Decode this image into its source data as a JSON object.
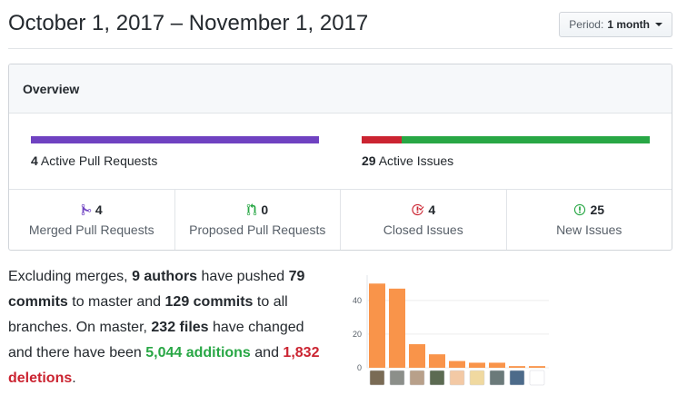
{
  "header": {
    "date_range": "October 1, 2017 – November 1, 2017",
    "period_label": "Period:",
    "period_value": "1 month"
  },
  "overview": {
    "title": "Overview",
    "pull_requests": {
      "count": "4",
      "label": "Active Pull Requests",
      "color": "#6f42c1"
    },
    "issues": {
      "count": "29",
      "label": "Active Issues",
      "closed_color": "#cb2431",
      "open_color": "#28a745",
      "closed": 4,
      "open": 25
    },
    "stats": [
      {
        "icon": "merged-pr-icon",
        "value": "4",
        "label": "Merged Pull Requests",
        "color": "#6f42c1"
      },
      {
        "icon": "proposed-pr-icon",
        "value": "0",
        "label": "Proposed Pull Requests",
        "color": "#28a745"
      },
      {
        "icon": "closed-issue-icon",
        "value": "4",
        "label": "Closed Issues",
        "color": "#cb2431"
      },
      {
        "icon": "new-issue-icon",
        "value": "25",
        "label": "New Issues",
        "color": "#28a745"
      }
    ]
  },
  "summary": {
    "t1": "Excluding merges, ",
    "authors": "9 authors",
    "t2": " have pushed ",
    "commits_master": "79 commits",
    "t3": " to master and ",
    "commits_all": "129 commits",
    "t4": " to all branches. On master, ",
    "files": "232 files",
    "t5": " have changed and there have been ",
    "additions": "5,044 additions",
    "t6": " and ",
    "deletions": "1,832 deletions",
    "t7": "."
  },
  "chart_data": {
    "type": "bar",
    "categories": [
      "author-1",
      "author-2",
      "author-3",
      "author-4",
      "author-5",
      "author-6",
      "author-7",
      "author-8",
      "author-9"
    ],
    "values": [
      50,
      47,
      14,
      8,
      4,
      3,
      3,
      1,
      1
    ],
    "yticks": [
      "0",
      "20",
      "40"
    ],
    "ylim": [
      0,
      55
    ],
    "bar_color": "#f9944a"
  }
}
